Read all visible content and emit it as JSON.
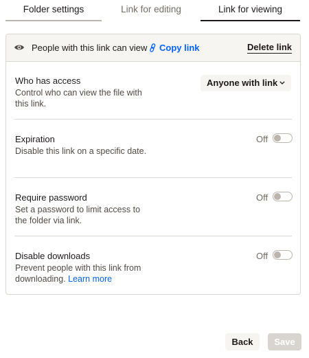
{
  "tabs": [
    {
      "label": "Folder settings"
    },
    {
      "label": "Link for editing"
    },
    {
      "label": "Link for viewing"
    }
  ],
  "header": {
    "text": "People with this link can view",
    "copy_link": "Copy link",
    "delete_link": "Delete link"
  },
  "access": {
    "title": "Who has access",
    "description": "Control who can view the file with this link.",
    "dropdown_value": "Anyone with link"
  },
  "expiration": {
    "title": "Expiration",
    "description": "Disable this link on a specific date.",
    "state": "Off"
  },
  "password": {
    "title": "Require password",
    "description": "Set a password to limit access to the folder via link.",
    "state": "Off"
  },
  "downloads": {
    "title": "Disable downloads",
    "description": "Prevent people with this link from downloading.",
    "learn_more": "Learn more",
    "state": "Off"
  },
  "footer": {
    "back": "Back",
    "save": "Save"
  },
  "colors": {
    "accent": "#0061fe",
    "text": "#1e1919",
    "muted": "#736c64",
    "border": "#dad6d1",
    "header_bg": "#f7f5f2"
  }
}
